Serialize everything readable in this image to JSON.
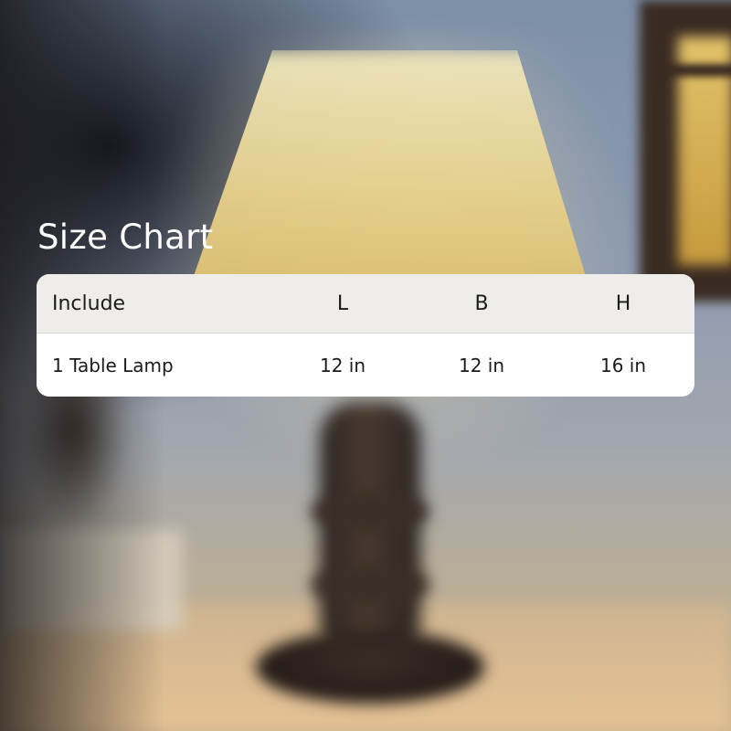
{
  "title": "Size Chart",
  "table": {
    "headers": {
      "include": "Include",
      "l": "L",
      "b": "B",
      "h": "H"
    },
    "rows": [
      {
        "include": "1 Table Lamp",
        "l": "12 in",
        "b": "12 in",
        "h": "16 in"
      }
    ]
  }
}
